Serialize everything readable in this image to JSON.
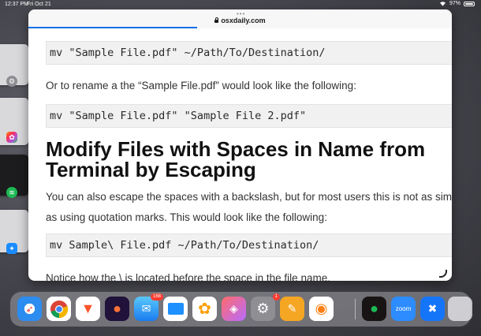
{
  "status_bar": {
    "time": "12:37 PM",
    "date": "Fri Oct 21",
    "battery": "97%"
  },
  "browser": {
    "url": "osxdaily.com"
  },
  "article": {
    "code_1": "mv \"Sample File.pdf\" ~/Path/To/Destination/",
    "para_1": "Or to rename a the “Sample File.pdf” would look like the following:",
    "code_2": "mv \"Sample File.pdf\" \"Sample File 2.pdf\"",
    "heading_line_1": "Modify Files with Spaces in Name from",
    "heading_line_2": "Terminal by Escaping",
    "para_2_line_1": "You can also escape the spaces with a backslash, but for most users this is not as simple",
    "para_2_line_2": "as using quotation marks. This would look like the following:",
    "code_3": "mv Sample\\ File.pdf ~/Path/To/Destination/",
    "para_3": "Notice how the \\ is located before the space in the file name."
  },
  "dock": {
    "apps": [
      {
        "name": "Safari",
        "icon": "compass-icon"
      },
      {
        "name": "Chrome",
        "icon": "chrome-icon"
      },
      {
        "name": "Brave",
        "icon": "lion-icon"
      },
      {
        "name": "Firefox",
        "icon": "fox-icon"
      },
      {
        "name": "Mail",
        "icon": "envelope-icon",
        "badge": "168"
      },
      {
        "name": "Files",
        "icon": "folder-icon"
      },
      {
        "name": "Photos",
        "icon": "flower-icon"
      },
      {
        "name": "Shortcuts",
        "icon": "shortcuts-icon"
      },
      {
        "name": "Settings",
        "icon": "gear-icon",
        "badge": "1"
      },
      {
        "name": "Pages",
        "icon": "pen-icon"
      },
      {
        "name": "Overcast",
        "icon": "podcast-icon"
      },
      {
        "name": "Spotify",
        "icon": "spotify-icon"
      },
      {
        "name": "Zoom",
        "icon": "zoom-icon",
        "label": "zoom"
      },
      {
        "name": "Xcode",
        "icon": "tools-icon"
      },
      {
        "name": "App Library",
        "icon": "grid-icon"
      }
    ]
  }
}
